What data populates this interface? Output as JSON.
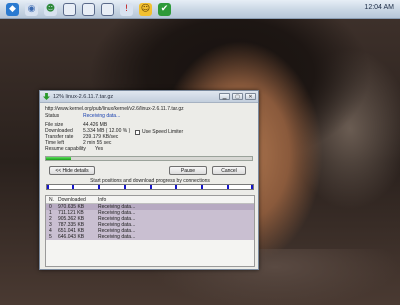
{
  "taskbar": {
    "icons": [
      "windows-icon",
      "chat-icon",
      "people-icon",
      "window-icon",
      "window-icon",
      "window-icon",
      "alert-icon",
      "smiley-icon",
      "checkmark-icon"
    ],
    "clock": "12:04 AM"
  },
  "window": {
    "title": "12% linux-2.6.11.7.tar.gz",
    "url": "http://www.kernel.org/pub/linux/kernel/v2.6/linux-2.6.11.7.tar.gz",
    "fields": [
      {
        "label": "Status",
        "value": "Receiving data..."
      },
      {
        "label": "File size",
        "value": "44.426 MB"
      },
      {
        "label": "Downloaded",
        "value": "5.334 MB  ( 12.00 % )"
      },
      {
        "label": "Transfer rate",
        "value": "239.179 KB/sec"
      },
      {
        "label": "Time left",
        "value": "2 min 55 sec"
      },
      {
        "label": "Resume capability",
        "value": "Yes"
      }
    ],
    "speed_limiter_label": "Use Speed Limiter",
    "progress": 0.12,
    "hide_details_label": "<< Hide details",
    "pause_label": "Pause",
    "cancel_label": "Cancel",
    "connections_caption": "Start positions and download progress by connections",
    "table": {
      "headers": [
        "N.",
        "Downloaded",
        "Info"
      ],
      "rows": [
        {
          "n": "0",
          "downloaded": "970.635 KB",
          "info": "Receiving data..."
        },
        {
          "n": "1",
          "downloaded": "711.121 KB",
          "info": "Receiving data..."
        },
        {
          "n": "2",
          "downloaded": "905.362 KB",
          "info": "Receiving data..."
        },
        {
          "n": "3",
          "downloaded": "787.335 KB",
          "info": "Receiving data..."
        },
        {
          "n": "4",
          "downloaded": "651.041 KB",
          "info": "Receiving data..."
        },
        {
          "n": "5",
          "downloaded": "646.043 KB",
          "info": "Receiving data..."
        }
      ]
    }
  }
}
